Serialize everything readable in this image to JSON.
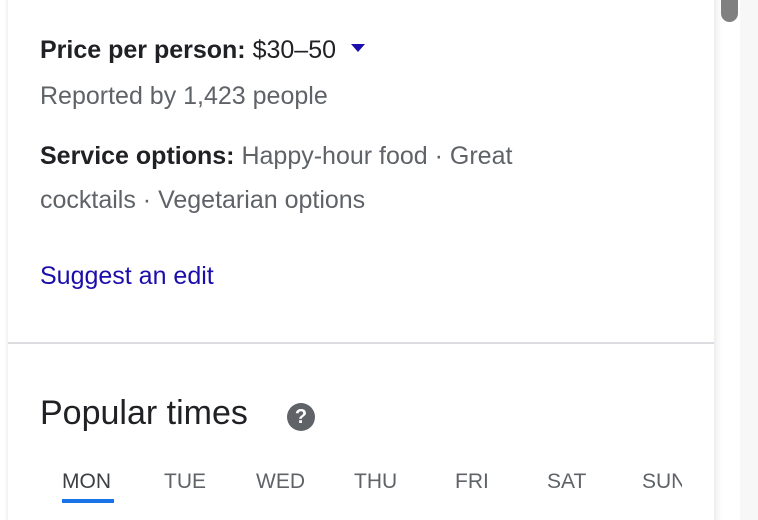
{
  "details": {
    "price_label": "Price per person:",
    "price_value": "$30–50",
    "reported": "Reported by 1,423 people",
    "service_label": "Service options:",
    "service_line1": "Happy-hour food · Great",
    "service_line2": "cocktails · Vegetarian options",
    "suggest_edit": "Suggest an edit"
  },
  "popular_times": {
    "title": "Popular times",
    "help_glyph": "?",
    "days": [
      "MON",
      "TUE",
      "WED",
      "THU",
      "FRI",
      "SAT",
      "SUN"
    ],
    "selected_day": "MON"
  },
  "colors": {
    "link": "#1a0dab",
    "accent": "#1a73e8",
    "text": "#202124",
    "muted": "#5f6368"
  },
  "icons": {
    "dropdown": "caret-down-icon",
    "help": "question-circle-icon"
  }
}
